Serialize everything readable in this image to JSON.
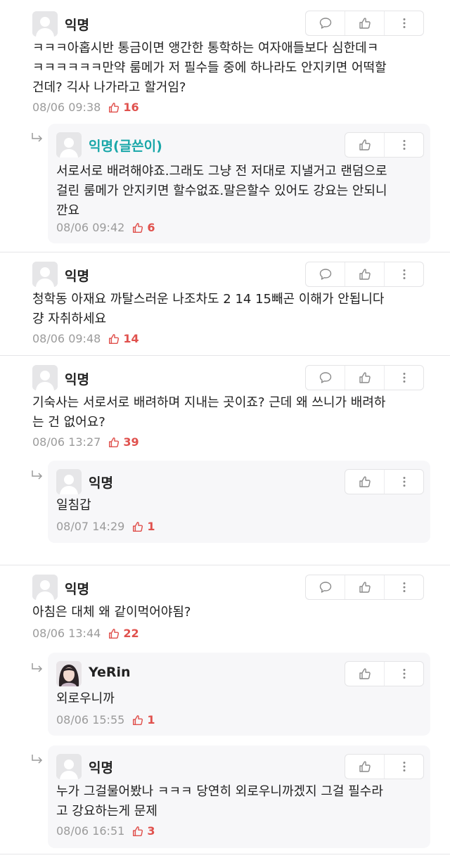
{
  "comments": [
    {
      "author": "익명",
      "text": "ㅋㅋㅋ아홉시반 통금이면 앵간한 통학하는 여자애들보다 심한데ㅋ\nㅋㅋㅋㅋㅋㅋ만약 룸메가 저 필수들 중에 하나라도 안지키면 어떡할\n건데? 긱사 나가라고 할거임?",
      "time": "08/06 09:38",
      "likes": "16",
      "replies": [
        {
          "author": "익명(글쓴이)",
          "text": "서로서로 배려해야죠.그래도 그냥 전 저대로 지낼거고 랜덤으로\n걸린 룸메가 안지키면 할수없죠.말은할수 있어도 강요는 안되니\n깐요",
          "time": "08/06 09:42",
          "likes": "6"
        }
      ]
    },
    {
      "author": "익명",
      "text": "청학동 아재요 까탈스러운 나조차도 2 14 15빼곤 이해가 안됩니다\n걍 자취하세요",
      "time": "08/06 09:48",
      "likes": "14"
    },
    {
      "author": "익명",
      "text": "기숙사는 서로서로 배려하며 지내는 곳이죠? 근데 왜 쓰니가 배려하\n는 건 없어요?",
      "time": "08/06 13:27",
      "likes": "39",
      "replies": [
        {
          "author": "익명",
          "text": "일침갑",
          "time": "08/07 14:29",
          "likes": "1"
        }
      ]
    },
    {
      "author": "익명",
      "text": "아침은 대체 왜 같이먹어야됨?",
      "time": "08/06 13:44",
      "likes": "22",
      "replies": [
        {
          "author": "YeRin",
          "text": "외로우니까",
          "time": "08/06 15:55",
          "likes": "1"
        },
        {
          "author": "익명",
          "text": "누가 그걸물어봤나 ㅋㅋㅋ 당연히 외로우니까겠지 그걸 필수라\n고 강요하는게 문제",
          "time": "08/06 16:51",
          "likes": "3"
        }
      ]
    }
  ],
  "icons": {
    "reply": "speech-bubble-icon",
    "like": "thumbs-up-icon",
    "more": "vertical-ellipsis-icon",
    "reply_indicator": "reply-arrow-icon",
    "avatar": "default-user-avatar-icon"
  },
  "colors": {
    "writer_name": "#1aa7a9",
    "like_count": "#e0514d",
    "meta_text": "#9b9b9b",
    "reply_background": "#f7f7f9"
  }
}
